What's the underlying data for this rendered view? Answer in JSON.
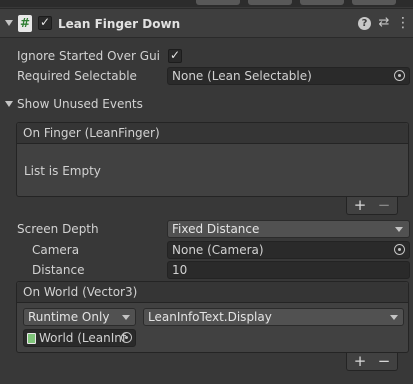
{
  "component": {
    "title": "Lean Finger Down",
    "enabled": true
  },
  "fields": {
    "ignore_started_over_gui": {
      "label": "Ignore Started Over Gui",
      "checked": true
    },
    "required_selectable": {
      "label": "Required Selectable",
      "value": "None (Lean Selectable)"
    },
    "show_unused_events": {
      "label": "Show Unused Events"
    }
  },
  "on_finger": {
    "header": "On Finger (LeanFinger)",
    "empty_text": "List is Empty",
    "add": "+",
    "remove": "−"
  },
  "screen_depth": {
    "label": "Screen Depth",
    "value": "Fixed Distance",
    "camera": {
      "label": "Camera",
      "value": "None (Camera)"
    },
    "distance": {
      "label": "Distance",
      "value": "10"
    }
  },
  "on_world": {
    "header": "On World (Vector3)",
    "runtime": "Runtime Only",
    "function": "LeanInfoText.Display",
    "object": "World (LeanInf",
    "add": "+",
    "remove": "−"
  },
  "colors": {
    "background": "#383838",
    "header": "#3e3e3e",
    "field": "#2a2a2a",
    "script_icon": "#7fc47a"
  }
}
